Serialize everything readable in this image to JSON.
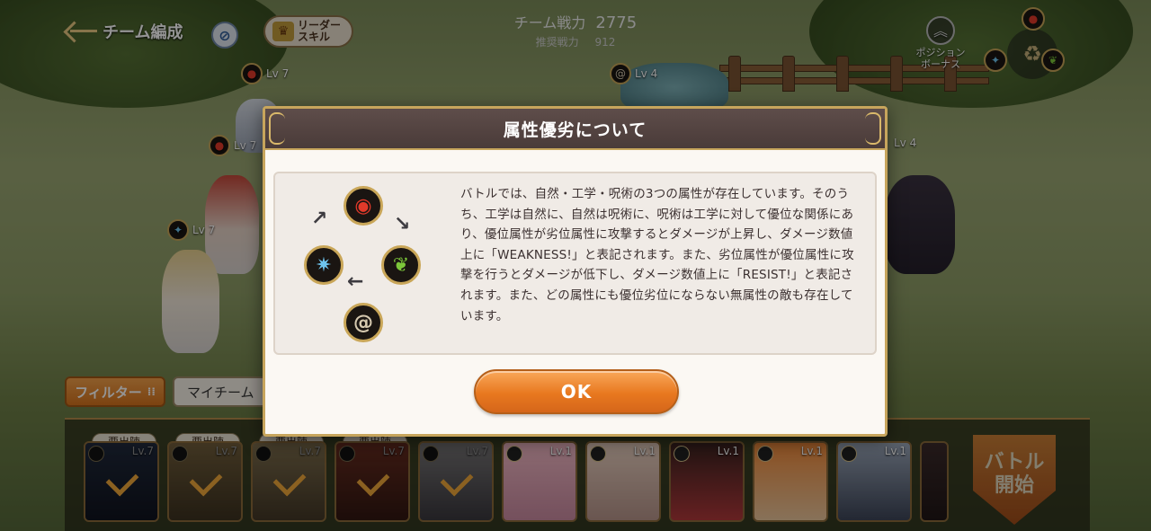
{
  "hud": {
    "back_label": "チーム編成",
    "leader_skill_label": "リーダー\nスキル",
    "team_power_label": "チーム戦力",
    "team_power_value": "2775",
    "recommended_power_label": "推奨戦力",
    "recommended_power_value": "912",
    "position_bonus_label": "ポジション\nボーナス"
  },
  "battlefield": {
    "levels": [
      "Lv 7",
      "Lv 4",
      "Lv 7",
      "Lv 7",
      "Lv 4"
    ]
  },
  "modal": {
    "title": "属性優劣について",
    "description": "バトルでは、自然・工学・呪術の3つの属性が存在しています。そのうち、工学は自然に、自然は呪術に、呪術は工学に対して優位な関係にあり、優位属性が劣位属性に攻撃するとダメージが上昇し、ダメージ数値上に「WEAKNESS!」と表記されます。また、劣位属性が優位属性に攻撃を行うとダメージが低下し、ダメージ数値上に「RESIST!」と表記されます。また、どの属性にも優位劣位にならない無属性の敵も存在しています。",
    "ok_label": "OK",
    "icons": [
      "fire-element-icon",
      "nature-element-icon",
      "star-element-icon",
      "spiral-element-icon"
    ]
  },
  "toolbar": {
    "filter_label": "フィルター",
    "team_select_label": "マイチーム"
  },
  "roster": {
    "required_badge": "要出陣",
    "cards": [
      {
        "lv": "Lv.7",
        "deployed": true
      },
      {
        "lv": "Lv.7",
        "deployed": true
      },
      {
        "lv": "Lv.7",
        "deployed": true
      },
      {
        "lv": "Lv.7",
        "deployed": true
      },
      {
        "lv": "Lv.7",
        "deployed": true
      },
      {
        "lv": "Lv.1",
        "deployed": false
      },
      {
        "lv": "Lv.1",
        "deployed": false
      },
      {
        "lv": "Lv.1",
        "deployed": false
      },
      {
        "lv": "Lv.1",
        "deployed": false
      },
      {
        "lv": "Lv.1",
        "deployed": false
      }
    ],
    "battle_start_label": "バトル\n開始"
  },
  "colors": {
    "accent_orange": "#e8781f",
    "modal_header": "#4e3f3d",
    "gold_border": "#c7a55c"
  }
}
